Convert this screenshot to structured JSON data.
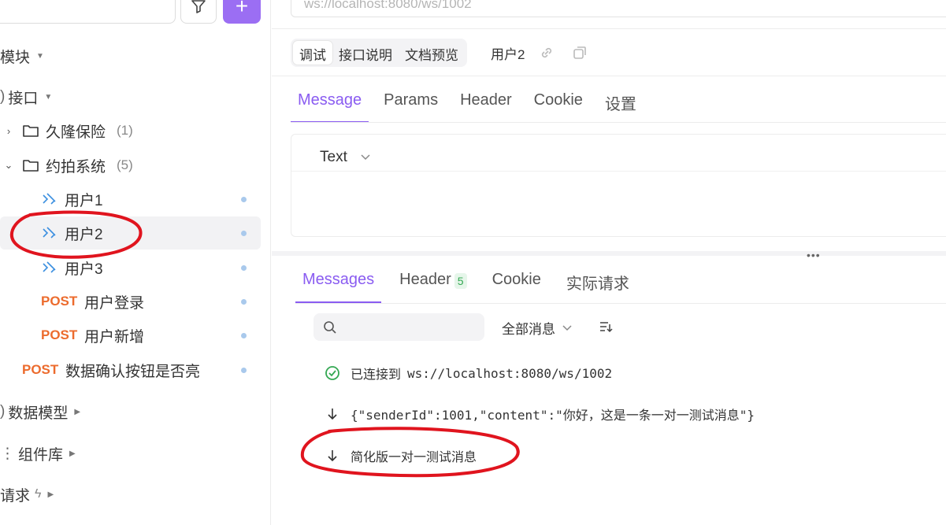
{
  "sidebar": {
    "sections": {
      "modules": "模块",
      "interfaces": "接口",
      "data_models": "数据模型",
      "components": "组件库",
      "requests": "请求"
    },
    "tree": [
      {
        "type": "folder",
        "label": "久隆保险",
        "count": "(1)",
        "expanded": false
      },
      {
        "type": "folder",
        "label": "约拍系统",
        "count": "(5)",
        "expanded": true
      },
      {
        "type": "ws",
        "label": "用户1"
      },
      {
        "type": "ws",
        "label": "用户2",
        "selected": true
      },
      {
        "type": "ws",
        "label": "用户3"
      },
      {
        "type": "post",
        "method": "POST",
        "label": "用户登录"
      },
      {
        "type": "post",
        "method": "POST",
        "label": "用户新增"
      },
      {
        "type": "post",
        "method": "POST",
        "label": "数据确认按钮是否亮"
      }
    ],
    "add_button": "+"
  },
  "url_bar": {
    "value": "ws://localhost:8080/ws/1002"
  },
  "mode_tabs": [
    "调试",
    "接口说明",
    "文档预览"
  ],
  "request_name": "用户2",
  "request_tabs": [
    "Message",
    "Params",
    "Header",
    "Cookie",
    "设置"
  ],
  "body": {
    "type": "Text"
  },
  "response_tabs": [
    {
      "label": "Messages"
    },
    {
      "label": "Header",
      "badge": "5"
    },
    {
      "label": "Cookie"
    },
    {
      "label": "实际请求"
    }
  ],
  "messages_filter": "全部消息",
  "messages": [
    {
      "icon": "check-circle-icon",
      "label": "已连接到",
      "text": "ws://localhost:8080/ws/1002"
    },
    {
      "icon": "arrow-down-icon",
      "label": "",
      "text": "{\"senderId\":1001,\"content\":\"你好，这是一条一对一测试消息\"}"
    },
    {
      "icon": "arrow-down-icon",
      "label": "",
      "text": "简化版一对一测试消息"
    }
  ],
  "colors": {
    "accent": "#8a5cf1",
    "post": "#ec6b2d",
    "success": "#34a853",
    "annotation": "#e0141e"
  }
}
